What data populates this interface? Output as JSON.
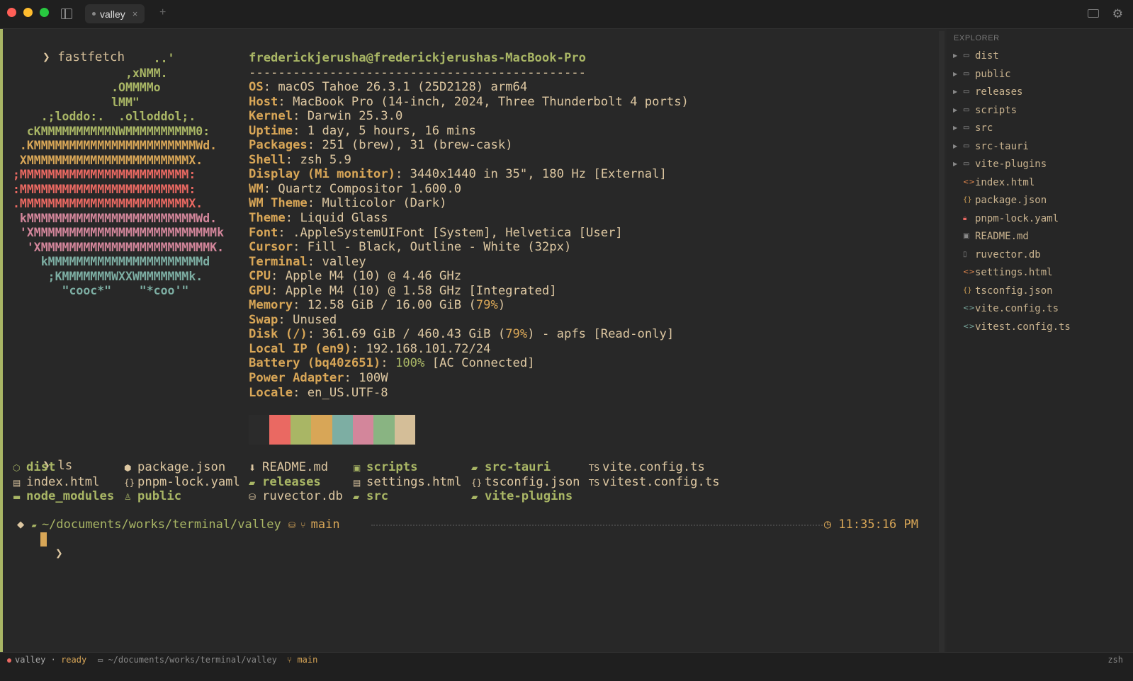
{
  "window": {
    "tab_title": "valley",
    "tab_close": "×",
    "new_tab": "+"
  },
  "colors": {
    "accent_green": "#a9b665",
    "accent_yellow": "#d8a657",
    "fg": "#ddc7a1",
    "bg": "#282828"
  },
  "terminal": {
    "prompt": "❯",
    "cmd1": "fastfetch",
    "logo": [
      {
        "text": "                    ..'",
        "color": "#a9b665"
      },
      {
        "text": "                ,xNMM.",
        "color": "#a9b665"
      },
      {
        "text": "              .OMMMMo",
        "color": "#a9b665"
      },
      {
        "text": "              lMM\"",
        "color": "#a9b665"
      },
      {
        "text": "    .;loddo:.  .olloddol;.",
        "color": "#a9b665"
      },
      {
        "text": "  cKMMMMMMMMMMNWMMMMMMMMMM0:",
        "color": "#a9b665"
      },
      {
        "text": " .KMMMMMMMMMMMMMMMMMMMMMMMWd.",
        "color": "#d8a657"
      },
      {
        "text": " XMMMMMMMMMMMMMMMMMMMMMMMX.",
        "color": "#d8a657"
      },
      {
        "text": ";MMMMMMMMMMMMMMMMMMMMMMMM:",
        "color": "#ea6962"
      },
      {
        "text": ":MMMMMMMMMMMMMMMMMMMMMMMM:",
        "color": "#ea6962"
      },
      {
        "text": ".MMMMMMMMMMMMMMMMMMMMMMMMX.",
        "color": "#ea6962"
      },
      {
        "text": " kMMMMMMMMMMMMMMMMMMMMMMMMWd.",
        "color": "#d3869b"
      },
      {
        "text": " 'XMMMMMMMMMMMMMMMMMMMMMMMMMMk",
        "color": "#d3869b"
      },
      {
        "text": "  'XMMMMMMMMMMMMMMMMMMMMMMMMK.",
        "color": "#d3869b"
      },
      {
        "text": "    kMMMMMMMMMMMMMMMMMMMMMMd",
        "color": "#7daea3"
      },
      {
        "text": "     ;KMMMMMMMWXXWMMMMMMMk.",
        "color": "#7daea3"
      },
      {
        "text": "       \"cooc*\"    \"*coo'\"",
        "color": "#7daea3"
      }
    ],
    "userhost": "frederickjerusha@frederickjerushas-MacBook-Pro",
    "separator": "----------------------------------------------",
    "info": [
      {
        "k": "OS",
        "v": "macOS Tahoe 26.3.1 (25D2128) arm64"
      },
      {
        "k": "Host",
        "v": "MacBook Pro (14-inch, 2024, Three Thunderbolt 4 ports)"
      },
      {
        "k": "Kernel",
        "v": "Darwin 25.3.0"
      },
      {
        "k": "Uptime",
        "v": "1 day, 5 hours, 16 mins"
      },
      {
        "k": "Packages",
        "v": "251 (brew), 31 (brew-cask)"
      },
      {
        "k": "Shell",
        "v": "zsh 5.9"
      },
      {
        "k": "Display (Mi monitor)",
        "v": "3440x1440 in 35\", 180 Hz [External]"
      },
      {
        "k": "WM",
        "v": "Quartz Compositor 1.600.0"
      },
      {
        "k": "WM Theme",
        "v": "Multicolor (Dark)"
      },
      {
        "k": "Theme",
        "v": "Liquid Glass"
      },
      {
        "k": "Font",
        "v": ".AppleSystemUIFont [System], Helvetica [User]"
      },
      {
        "k": "Cursor",
        "v": "Fill - Black, Outline - White (32px)"
      },
      {
        "k": "Terminal",
        "v": "valley"
      },
      {
        "k": "CPU",
        "v": "Apple M4 (10) @ 4.46 GHz"
      },
      {
        "k": "GPU",
        "v": "Apple M4 (10) @ 1.58 GHz [Integrated]"
      },
      {
        "k": "Memory",
        "v": "12.58 GiB / 16.00 GiB (",
        "pct": "79%",
        "tail": ")"
      },
      {
        "k": "Swap",
        "v": "Unused"
      },
      {
        "k": "Disk (/)",
        "v": "361.69 GiB / 460.43 GiB (",
        "pct": "79%",
        "tail": ") - apfs [Read-only]"
      },
      {
        "k": "Local IP (en9)",
        "v": "192.168.101.72/24"
      },
      {
        "k": "Battery (bq40z651)",
        "v": "",
        "pct": "100%",
        "pct_green": true,
        "tail": " [AC Connected]"
      },
      {
        "k": "Power Adapter",
        "v": "100W"
      },
      {
        "k": "Locale",
        "v": "en_US.UTF-8"
      }
    ],
    "palette": [
      "#2b2b2b",
      "#ea6962",
      "#a9b665",
      "#d8a657",
      "#7daea3",
      "#d3869b",
      "#89b482",
      "#d4be98"
    ],
    "cmd2": "ls",
    "ls": [
      {
        "name": "dist",
        "icon": "⬡",
        "dir": true,
        "col": 0,
        "row": 0
      },
      {
        "name": "index.html",
        "icon": "▤",
        "dir": false,
        "col": 0,
        "row": 1
      },
      {
        "name": "node_modules",
        "icon": "▬",
        "dir": true,
        "col": 0,
        "row": 2
      },
      {
        "name": "package.json",
        "icon": "⬢",
        "dir": false,
        "col": 1,
        "row": 0
      },
      {
        "name": "pnpm-lock.yaml",
        "icon": "{}",
        "dir": false,
        "col": 1,
        "row": 1
      },
      {
        "name": "public",
        "icon": "♙",
        "dir": true,
        "col": 1,
        "row": 2
      },
      {
        "name": "README.md",
        "icon": "⬇",
        "dir": false,
        "col": 2,
        "row": 0
      },
      {
        "name": "releases",
        "icon": "▰",
        "dir": true,
        "col": 2,
        "row": 1
      },
      {
        "name": "ruvector.db",
        "icon": "⛁",
        "dir": false,
        "col": 2,
        "row": 2
      },
      {
        "name": "scripts",
        "icon": "▣",
        "dir": true,
        "col": 3,
        "row": 0
      },
      {
        "name": "settings.html",
        "icon": "▤",
        "dir": false,
        "col": 3,
        "row": 1
      },
      {
        "name": "src",
        "icon": "▰",
        "dir": true,
        "col": 3,
        "row": 2
      },
      {
        "name": "src-tauri",
        "icon": "▰",
        "dir": true,
        "col": 4,
        "row": 0
      },
      {
        "name": "tsconfig.json",
        "icon": "{}",
        "dir": false,
        "col": 4,
        "row": 1
      },
      {
        "name": "vite-plugins",
        "icon": "▰",
        "dir": true,
        "col": 4,
        "row": 2
      },
      {
        "name": "vite.config.ts",
        "icon": "TS",
        "dir": false,
        "col": 5,
        "row": 0
      },
      {
        "name": "vitest.config.ts",
        "icon": "TS",
        "dir": false,
        "col": 5,
        "row": 1
      }
    ],
    "prompt_bar": {
      "path": "~/documents/works/terminal/valley",
      "branch": "main",
      "time": "11:35:16 PM"
    }
  },
  "explorer": {
    "title": "EXPLORER",
    "items": [
      {
        "name": "dist",
        "folder": true,
        "icon": "▭"
      },
      {
        "name": "public",
        "folder": true,
        "icon": "▭"
      },
      {
        "name": "releases",
        "folder": true,
        "icon": "▭"
      },
      {
        "name": "scripts",
        "folder": true,
        "icon": "▭"
      },
      {
        "name": "src",
        "folder": true,
        "icon": "▭"
      },
      {
        "name": "src-tauri",
        "folder": true,
        "icon": "▭"
      },
      {
        "name": "vite-plugins",
        "folder": true,
        "icon": "▭"
      },
      {
        "name": "index.html",
        "folder": false,
        "icon": "<>",
        "color": "#e78a4e"
      },
      {
        "name": "package.json",
        "folder": false,
        "icon": "{}",
        "color": "#d8a657"
      },
      {
        "name": "pnpm-lock.yaml",
        "folder": false,
        "icon": "🔒︎",
        "color": "#ea6962"
      },
      {
        "name": "README.md",
        "folder": false,
        "icon": "▣",
        "color": "#888"
      },
      {
        "name": "ruvector.db",
        "folder": false,
        "icon": "▯",
        "color": "#888"
      },
      {
        "name": "settings.html",
        "folder": false,
        "icon": "<>",
        "color": "#e78a4e"
      },
      {
        "name": "tsconfig.json",
        "folder": false,
        "icon": "{}",
        "color": "#d8a657"
      },
      {
        "name": "vite.config.ts",
        "folder": false,
        "icon": "<>",
        "color": "#7daea3"
      },
      {
        "name": "vitest.config.ts",
        "folder": false,
        "icon": "<>",
        "color": "#7daea3"
      }
    ]
  },
  "status": {
    "session": "valley",
    "state": "ready",
    "path": "~/documents/works/terminal/valley",
    "branch": "main",
    "shell": "zsh",
    "sep": "·"
  }
}
